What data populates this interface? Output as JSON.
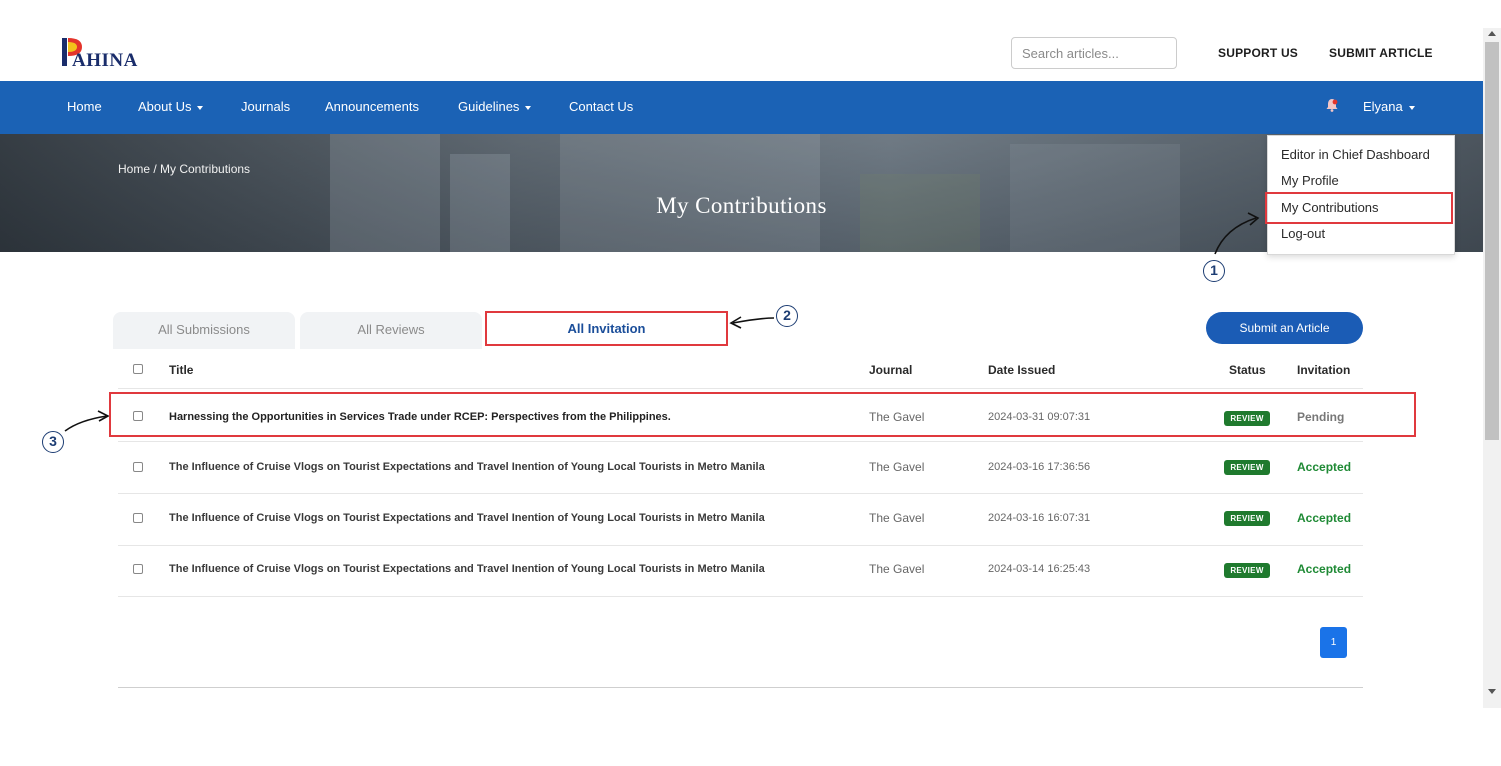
{
  "brand": {
    "logo_text": "AHINA"
  },
  "search": {
    "placeholder": "Search articles..."
  },
  "top_links": {
    "support": "SUPPORT US",
    "submit_article": "SUBMIT ARTICLE"
  },
  "nav": {
    "items": [
      "Home",
      "About Us",
      "Journals",
      "Announcements",
      "Guidelines",
      "Contact Us"
    ],
    "user": "Elyana"
  },
  "hero": {
    "breadcrumb": "Home / My Contributions",
    "title": "My Contributions"
  },
  "user_menu": {
    "items": [
      "Editor in Chief Dashboard",
      "My Profile",
      "My Contributions",
      "Log-out"
    ]
  },
  "annotations": {
    "one": "1",
    "two": "2",
    "three": "3"
  },
  "tabs": [
    "All Submissions",
    "All Reviews",
    "All Invitation"
  ],
  "submit_button": "Submit an Article",
  "table": {
    "headers": {
      "title": "Title",
      "journal": "Journal",
      "date": "Date Issued",
      "status": "Status",
      "invitation": "Invitation"
    },
    "rows": [
      {
        "title": "Harnessing the Opportunities in Services Trade under RCEP: Perspectives from the Philippines.",
        "journal": "The Gavel",
        "date": "2024-03-31 09:07:31",
        "status": "REVIEW",
        "invitation": "Pending"
      },
      {
        "title": "The Influence of Cruise Vlogs on Tourist Expectations and Travel Inention of Young Local Tourists in Metro Manila",
        "journal": "The Gavel",
        "date": "2024-03-16 17:36:56",
        "status": "REVIEW",
        "invitation": "Accepted"
      },
      {
        "title": "The Influence of Cruise Vlogs on Tourist Expectations and Travel Inention of Young Local Tourists in Metro Manila",
        "journal": "The Gavel",
        "date": "2024-03-16 16:07:31",
        "status": "REVIEW",
        "invitation": "Accepted"
      },
      {
        "title": "The Influence of Cruise Vlogs on Tourist Expectations and Travel Inention of Young Local Tourists in Metro Manila",
        "journal": "The Gavel",
        "date": "2024-03-14 16:25:43",
        "status": "REVIEW",
        "invitation": "Accepted"
      }
    ]
  },
  "pagination": {
    "current": "1"
  },
  "colors": {
    "nav_blue": "#1b62b5",
    "badge_green": "#1f7a2e",
    "accepted_green": "#1f8a35",
    "highlight_red": "#e0393e"
  }
}
